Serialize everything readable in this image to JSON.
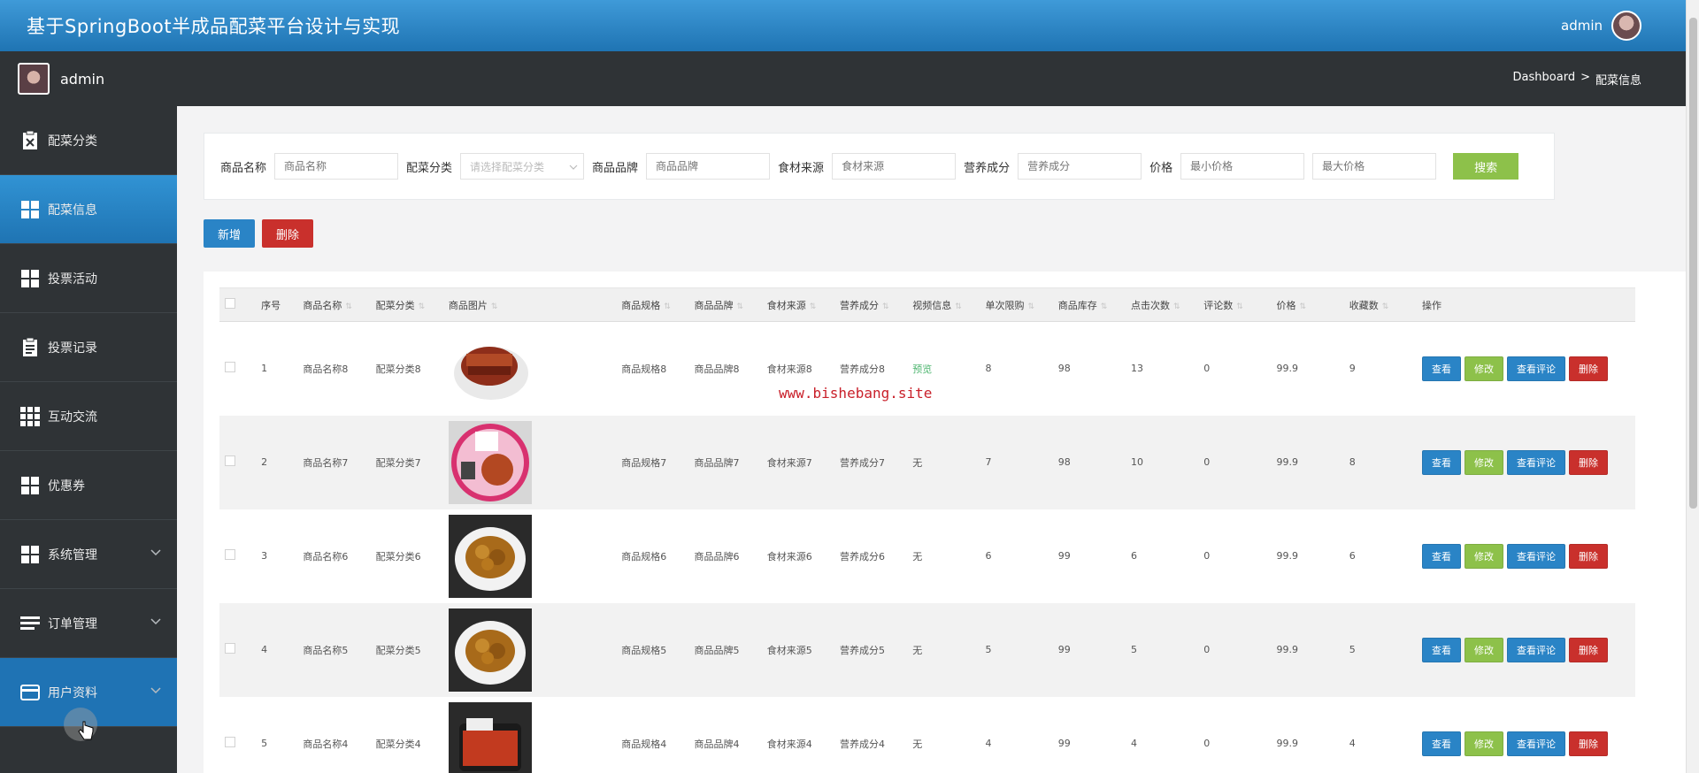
{
  "app": {
    "title": "基于SpringBoot半成品配菜平台设计与实现",
    "user": "admin"
  },
  "subbar": {
    "user": "admin",
    "breadcrumb": [
      "Dashboard",
      ">",
      "配菜信息"
    ]
  },
  "sidebar": {
    "items": [
      {
        "label": "配菜分类",
        "icon": "clipboard-x-icon",
        "state": "normal",
        "expandable": false
      },
      {
        "label": "配菜信息",
        "icon": "grid-icon",
        "state": "active",
        "expandable": false
      },
      {
        "label": "投票活动",
        "icon": "grid-icon",
        "state": "normal",
        "expandable": false
      },
      {
        "label": "投票记录",
        "icon": "clipboard-list-icon",
        "state": "normal",
        "expandable": false
      },
      {
        "label": "互动交流",
        "icon": "grid-3x3-icon",
        "state": "normal",
        "expandable": false
      },
      {
        "label": "优惠券",
        "icon": "grid-icon",
        "state": "normal",
        "expandable": false
      },
      {
        "label": "系统管理",
        "icon": "grid-icon",
        "state": "normal",
        "expandable": true
      },
      {
        "label": "订单管理",
        "icon": "list-icon",
        "state": "normal",
        "expandable": true
      },
      {
        "label": "用户资料",
        "icon": "card-icon",
        "state": "hover",
        "expandable": true
      }
    ]
  },
  "search": {
    "fields": [
      {
        "label": "商品名称",
        "placeholder": "商品名称",
        "type": "input"
      },
      {
        "label": "配菜分类",
        "placeholder": "请选择配菜分类",
        "type": "select"
      },
      {
        "label": "商品品牌",
        "placeholder": "商品品牌",
        "type": "input"
      },
      {
        "label": "食材来源",
        "placeholder": "食材来源",
        "type": "input"
      },
      {
        "label": "营养成分",
        "placeholder": "营养成分",
        "type": "input"
      }
    ],
    "price_label": "价格",
    "min_price_placeholder": "最小价格",
    "max_price_placeholder": "最大价格",
    "button": "搜索"
  },
  "actions": {
    "add": "新增",
    "delete": "删除"
  },
  "table": {
    "headers": [
      "序号",
      "商品名称",
      "配菜分类",
      "商品图片",
      "商品规格",
      "商品品牌",
      "食材来源",
      "营养成分",
      "视频信息",
      "单次限购",
      "商品库存",
      "点击次数",
      "评论数",
      "价格",
      "收藏数",
      "操作"
    ],
    "rows": [
      {
        "no": "1",
        "name": "商品名称8",
        "category": "配菜分类8",
        "image": "braised-pork-dish",
        "spec": "商品规格8",
        "brand": "商品品牌8",
        "source": "食材来源8",
        "nutrition": "营养成分8",
        "video": "预览",
        "limit": "8",
        "stock": "98",
        "clicks": "13",
        "comments": "0",
        "price": "99.9",
        "favorites": "9"
      },
      {
        "no": "2",
        "name": "商品名称7",
        "category": "配菜分类7",
        "image": "packaged-meal-box",
        "spec": "商品规格7",
        "brand": "商品品牌7",
        "source": "食材来源7",
        "nutrition": "营养成分7",
        "video": "无",
        "limit": "7",
        "stock": "98",
        "clicks": "10",
        "comments": "0",
        "price": "99.9",
        "favorites": "8"
      },
      {
        "no": "3",
        "name": "商品名称6",
        "category": "配菜分类6",
        "image": "braised-meat-bowl",
        "spec": "商品规格6",
        "brand": "商品品牌6",
        "source": "食材来源6",
        "nutrition": "营养成分6",
        "video": "无",
        "limit": "6",
        "stock": "99",
        "clicks": "6",
        "comments": "0",
        "price": "99.9",
        "favorites": "6"
      },
      {
        "no": "4",
        "name": "商品名称5",
        "category": "配菜分类5",
        "image": "braised-meat-bowl",
        "spec": "商品规格5",
        "brand": "商品品牌5",
        "source": "食材来源5",
        "nutrition": "营养成分5",
        "video": "无",
        "limit": "5",
        "stock": "99",
        "clicks": "5",
        "comments": "0",
        "price": "99.9",
        "favorites": "5"
      },
      {
        "no": "5",
        "name": "商品名称4",
        "category": "配菜分类4",
        "image": "packaged-tray-meal",
        "spec": "商品规格4",
        "brand": "商品品牌4",
        "source": "食材来源4",
        "nutrition": "营养成分4",
        "video": "无",
        "limit": "4",
        "stock": "99",
        "clicks": "4",
        "comments": "0",
        "price": "99.9",
        "favorites": "4"
      }
    ],
    "row_actions": {
      "view": "查看",
      "edit": "修改",
      "comments": "查看评论",
      "delete": "删除"
    }
  },
  "watermark": "www.bishebang.site",
  "colors": {
    "primary": "#2a84c6",
    "success": "#8dc14a",
    "danger": "#c9302c",
    "sidebar": "#2f3336",
    "topbar": "#1f74b3"
  }
}
